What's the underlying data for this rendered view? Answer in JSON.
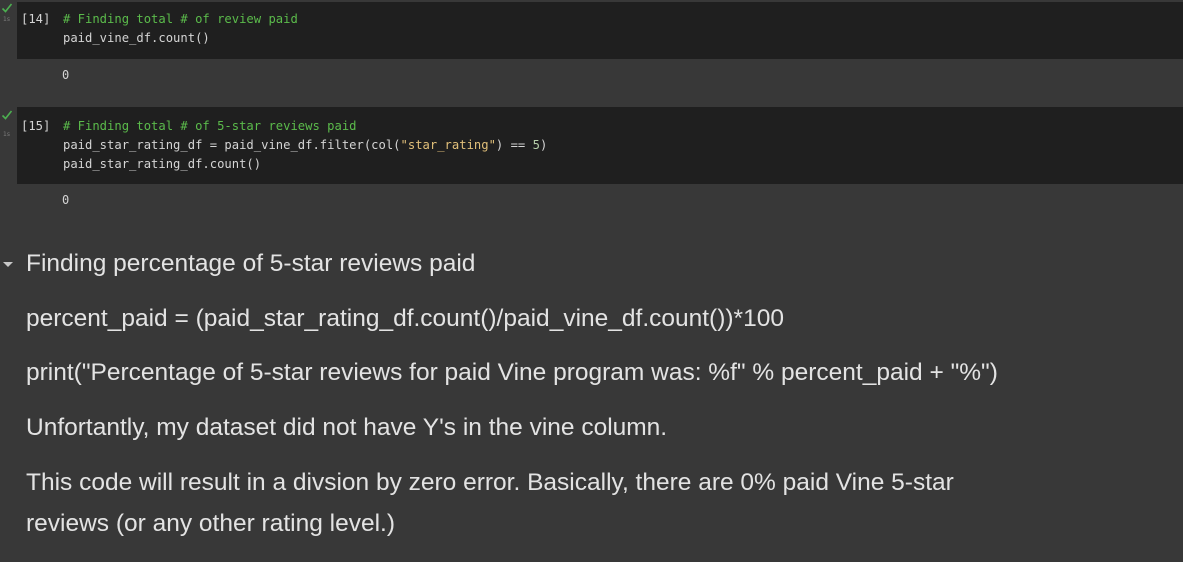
{
  "cells": [
    {
      "exec_time": "1s",
      "exec_count": "[14]",
      "comment": "# Finding total # of review paid",
      "line2": "paid_vine_df.count()",
      "output": "0"
    },
    {
      "exec_time": "1s",
      "exec_count": "[15]",
      "comment": "# Finding total # of 5-star reviews paid",
      "line2_a": "paid_star_rating_df = paid_vine_df.filter(col(",
      "line2_str": "\"star_rating\"",
      "line2_b": ") == ",
      "line2_num": "5",
      "line2_c": ")",
      "line3": "paid_star_rating_df.count()",
      "output": "0"
    }
  ],
  "markdown": {
    "heading": "Finding percentage of 5-star reviews paid",
    "p1": "percent_paid = (paid_star_rating_df.count()/paid_vine_df.count())*100",
    "p2": "print(\"Percentage of 5-star reviews for paid Vine program was: %f\" % percent_paid + \"%\")",
    "p3": "Unfortantly, my dataset did not have Y's in the vine column.",
    "p4": "This code will result in a divsion by zero error. Basically, there are 0% paid Vine 5-star reviews (or any other rating level.)"
  },
  "colors": {
    "background": "#383838",
    "code_background": "#1f1f1f",
    "comment": "#5bbb4b",
    "string": "#e2c07a",
    "check": "#4caf50"
  }
}
